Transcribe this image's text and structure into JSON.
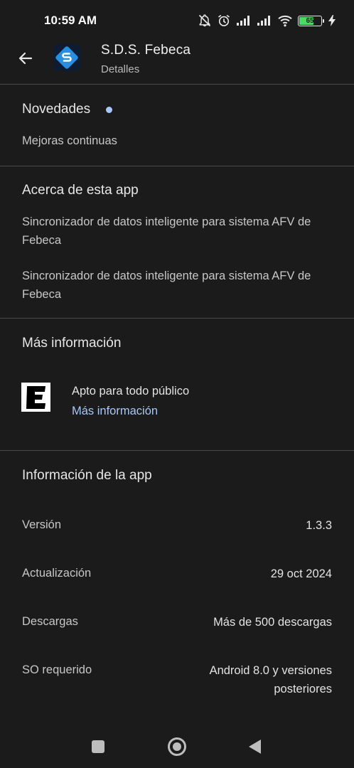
{
  "status_bar": {
    "time": "10:59 AM",
    "battery_level": "65",
    "battery_fraction": 0.65,
    "icons": [
      "notifications-off-icon",
      "alarm-icon",
      "signal-icon",
      "signal-icon",
      "wifi-icon",
      "battery-icon",
      "charging-icon"
    ]
  },
  "header": {
    "back_icon": "arrow-left-icon",
    "app_name": "S.D.S. Febeca",
    "subtitle": "Detalles"
  },
  "whats_new": {
    "title": "Novedades",
    "text": "Mejoras continuas"
  },
  "about": {
    "title": "Acerca de esta app",
    "paragraph_1": "Sincronizador de datos inteligente para sistema AFV de Febeca",
    "paragraph_2": "Sincronizador de datos inteligente para sistema AFV de Febeca"
  },
  "more_info": {
    "title": "Más información",
    "rating_label": "Apto para todo público",
    "rating_link": "Más información"
  },
  "app_info": {
    "title": "Información de la app",
    "rows": [
      {
        "label": "Versión",
        "value": "1.3.3"
      },
      {
        "label": "Actualización",
        "value": "29 oct 2024"
      },
      {
        "label": "Descargas",
        "value": "Más de 500 descargas"
      },
      {
        "label": "SO requerido",
        "value": "Android 8.0 y versiones posteriores"
      }
    ]
  },
  "colors": {
    "background": "#1b1b1b",
    "accent": "#a8c7fa",
    "divider": "#4a4a4a",
    "battery": "#4cd964"
  }
}
